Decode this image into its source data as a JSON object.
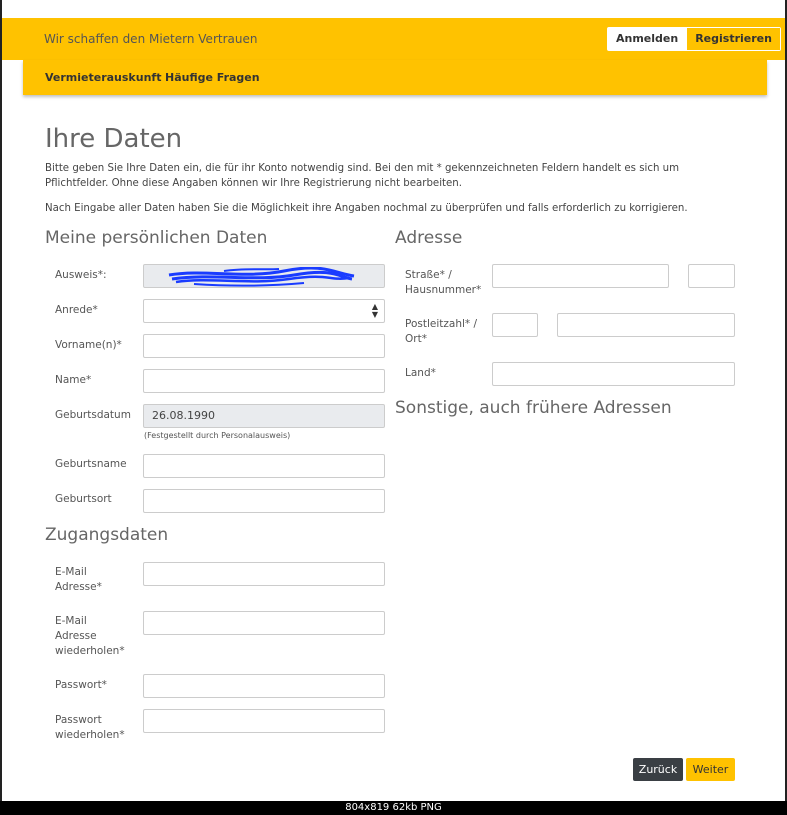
{
  "header": {
    "tagline": "Wir schaffen den Mietern Vertrauen",
    "login_label": "Anmelden",
    "register_label": "Registrieren"
  },
  "nav": {
    "items": [
      "Vermieterauskunft",
      "Häufige Fragen"
    ]
  },
  "page": {
    "title": "Ihre Daten",
    "intro_1": "Bitte geben Sie Ihre Daten ein, die für ihr Konto notwendig sind. Bei den mit * gekennzeichneten Feldern handelt es sich um Pflichtfelder. Ohne diese Angaben können wir Ihre Registrierung nicht bearbeiten.",
    "intro_2": "Nach Eingabe aller Daten haben Sie die Möglichkeit ihre Angaben nochmal zu überprüfen und falls erforderlich zu korrigieren."
  },
  "personal": {
    "section_title": "Meine persönlichen Daten",
    "id_label": "Ausweis*:",
    "salutation_label": "Anrede*",
    "salutation_value": "",
    "firstname_label": "Vorname(n)*",
    "name_label": "Name*",
    "birthdate_label": "Geburtsdatum",
    "birthdate_value": "26.08.1990",
    "birthdate_hint": "(Festgestellt durch Personalausweis)",
    "birthname_label": "Geburtsname",
    "birthplace_label": "Geburtsort"
  },
  "access": {
    "section_title": "Zugangsdaten",
    "email_label": "E-Mail Adresse*",
    "email_repeat_label": "E-Mail Adresse wiederholen*",
    "password_label": "Passwort*",
    "password_repeat_label": "Passwort wiederholen*"
  },
  "address": {
    "section_title": "Adresse",
    "street_label": "Straße* / Hausnummer*",
    "zip_label": "Postleitzahl* / Ort*",
    "country_label": "Land*",
    "other_title": "Sonstige, auch frühere Adressen"
  },
  "actions": {
    "back_label": "Zurück",
    "next_label": "Weiter"
  },
  "status_bar": "804x819  62kb  PNG",
  "colors": {
    "accent": "#ffc200",
    "dark_button": "#3a3f44",
    "readonly_field": "#e9ebee",
    "scribble": "#1a3cff"
  }
}
